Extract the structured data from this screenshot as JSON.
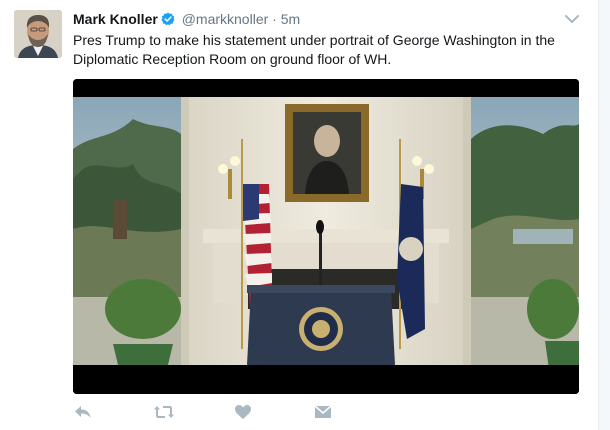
{
  "tweet": {
    "author_name": "Mark Knoller",
    "handle": "@markknoller",
    "separator": "·",
    "time": "5m",
    "text": "Pres Trump to make his statement under portrait of George Washington in the Diplomatic Reception Room on ground floor of WH."
  },
  "icons": {
    "verified": "verified-badge-icon",
    "caret": "chevron-down-icon",
    "reply": "reply-icon",
    "retweet": "retweet-icon",
    "like": "heart-icon",
    "message": "envelope-icon"
  },
  "colors": {
    "verified": "#1da1f2",
    "text": "#14171a",
    "muted": "#657786",
    "action_icon": "#aab8c2"
  }
}
